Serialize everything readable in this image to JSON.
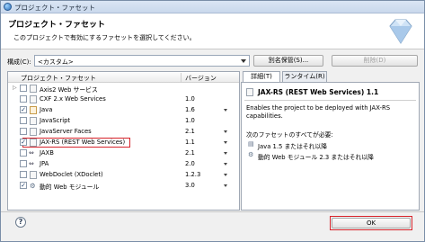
{
  "window": {
    "title": "プロジェクト・ファセット"
  },
  "header": {
    "title": "プロジェクト・ファセット",
    "description": "このプロジェクトで有効にするファセットを選択してください。"
  },
  "configuration": {
    "label": "構成(C):",
    "selected": "<カスタム>",
    "save_as_label": "別名保管(S)...",
    "delete_label": "削除(D)"
  },
  "facet_table": {
    "columns": [
      "プロジェクト・ファセット",
      "バージョン"
    ],
    "rows": [
      {
        "name": "Axis2 Web サービス",
        "version": "",
        "checked": false,
        "expandable": true,
        "has_dropdown": false
      },
      {
        "name": "CXF 2.x Web Services",
        "version": "1.0",
        "checked": false,
        "expandable": false,
        "has_dropdown": false
      },
      {
        "name": "Java",
        "version": "1.6",
        "checked": true,
        "expandable": false,
        "has_dropdown": true
      },
      {
        "name": "JavaScript",
        "version": "1.0",
        "checked": false,
        "expandable": false,
        "has_dropdown": false
      },
      {
        "name": "JavaServer Faces",
        "version": "2.1",
        "checked": false,
        "expandable": false,
        "has_dropdown": true
      },
      {
        "name": "JAX-RS (REST Web Services)",
        "version": "1.1",
        "checked": true,
        "expandable": false,
        "has_dropdown": true,
        "highlighted": true
      },
      {
        "name": "JAXB",
        "version": "2.1",
        "checked": false,
        "expandable": false,
        "has_dropdown": true
      },
      {
        "name": "JPA",
        "version": "2.0",
        "checked": false,
        "expandable": false,
        "has_dropdown": true
      },
      {
        "name": "WebDoclet (XDoclet)",
        "version": "1.2.3",
        "checked": false,
        "expandable": false,
        "has_dropdown": true
      },
      {
        "name": "動的 Web モジュール",
        "version": "3.0",
        "checked": true,
        "expandable": false,
        "has_dropdown": true
      }
    ]
  },
  "details": {
    "tabs": [
      "詳細(T)",
      "ランタイム(R)"
    ],
    "title": "JAX-RS (REST Web Services) 1.1",
    "description": "Enables the project to be deployed with JAX-RS capabilities.",
    "requires_label": "次のファセットのすべてが必要:",
    "requirements": [
      "Java 1.5 またはそれ以降",
      "動的 Web モジュール 2.3 またはそれ以降"
    ]
  },
  "footer": {
    "help_symbol": "?",
    "ok_label": "OK"
  },
  "colors": {
    "highlight": "#d7232a",
    "background": "#f0f0f0"
  }
}
